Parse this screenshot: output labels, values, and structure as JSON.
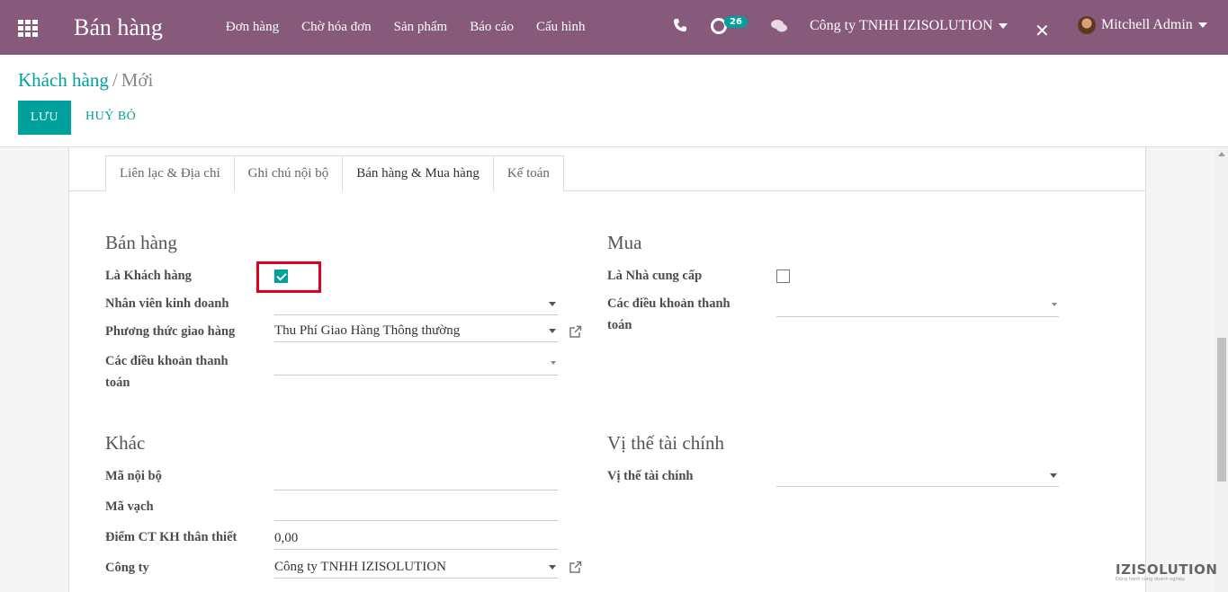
{
  "navbar": {
    "app_name": "Bán hàng",
    "menu": [
      "Đơn hàng",
      "Chờ hóa đơn",
      "Sản phẩm",
      "Báo cáo",
      "Cấu hình"
    ],
    "activity_count": "26",
    "company": "Công ty TNHH IZISOLUTION",
    "user": "Mitchell Admin",
    "icons": [
      "apps-icon",
      "phone-icon",
      "activity-icon",
      "chat-icon",
      "tools-icon"
    ]
  },
  "breadcrumb": {
    "parent": "Khách hàng",
    "separator": "/",
    "current": "Mới"
  },
  "buttons": {
    "save": "LƯU",
    "discard": "HUỶ BỎ"
  },
  "tabs": [
    {
      "label": "Liên lạc & Địa chỉ"
    },
    {
      "label": "Ghi chú nội bộ"
    },
    {
      "label": "Bán hàng & Mua hàng",
      "active": true
    },
    {
      "label": "Kế toán"
    }
  ],
  "sales": {
    "title": "Bán hàng",
    "is_customer_label": "Là Khách hàng",
    "is_customer": true,
    "salesperson_label": "Nhân viên kinh doanh",
    "salesperson_value": "",
    "delivery_method_label": "Phương thức giao hàng",
    "delivery_method_value": "Thu Phí Giao Hàng Thông thường",
    "payment_terms_label_1": "Các điều khoản thanh",
    "payment_terms_label_2": "toán",
    "payment_terms_value": ""
  },
  "purchase": {
    "title": "Mua",
    "is_vendor_label": "Là Nhà cung cấp",
    "is_vendor": false,
    "payment_terms_label_1": "Các điều khoản thanh",
    "payment_terms_label_2": "toán",
    "payment_terms_value": ""
  },
  "misc": {
    "title": "Khác",
    "internal_ref_label": "Mã nội bộ",
    "internal_ref_value": "",
    "barcode_label": "Mã vạch",
    "barcode_value": "",
    "loyalty_label": "Điểm CT KH thân thiết",
    "loyalty_value": "0,00",
    "company_label": "Công ty",
    "company_value": "Công ty TNHH IZISOLUTION"
  },
  "fiscal": {
    "title": "Vị thế tài chính",
    "position_label": "Vị thế tài chính",
    "position_value": ""
  },
  "watermark": {
    "name": "IZISOLUTION",
    "tagline": "Đồng hành cùng doanh nghiệp"
  },
  "colors": {
    "navbar": "#875a7b",
    "accent": "#00a09d",
    "highlight": "#e0001b"
  }
}
